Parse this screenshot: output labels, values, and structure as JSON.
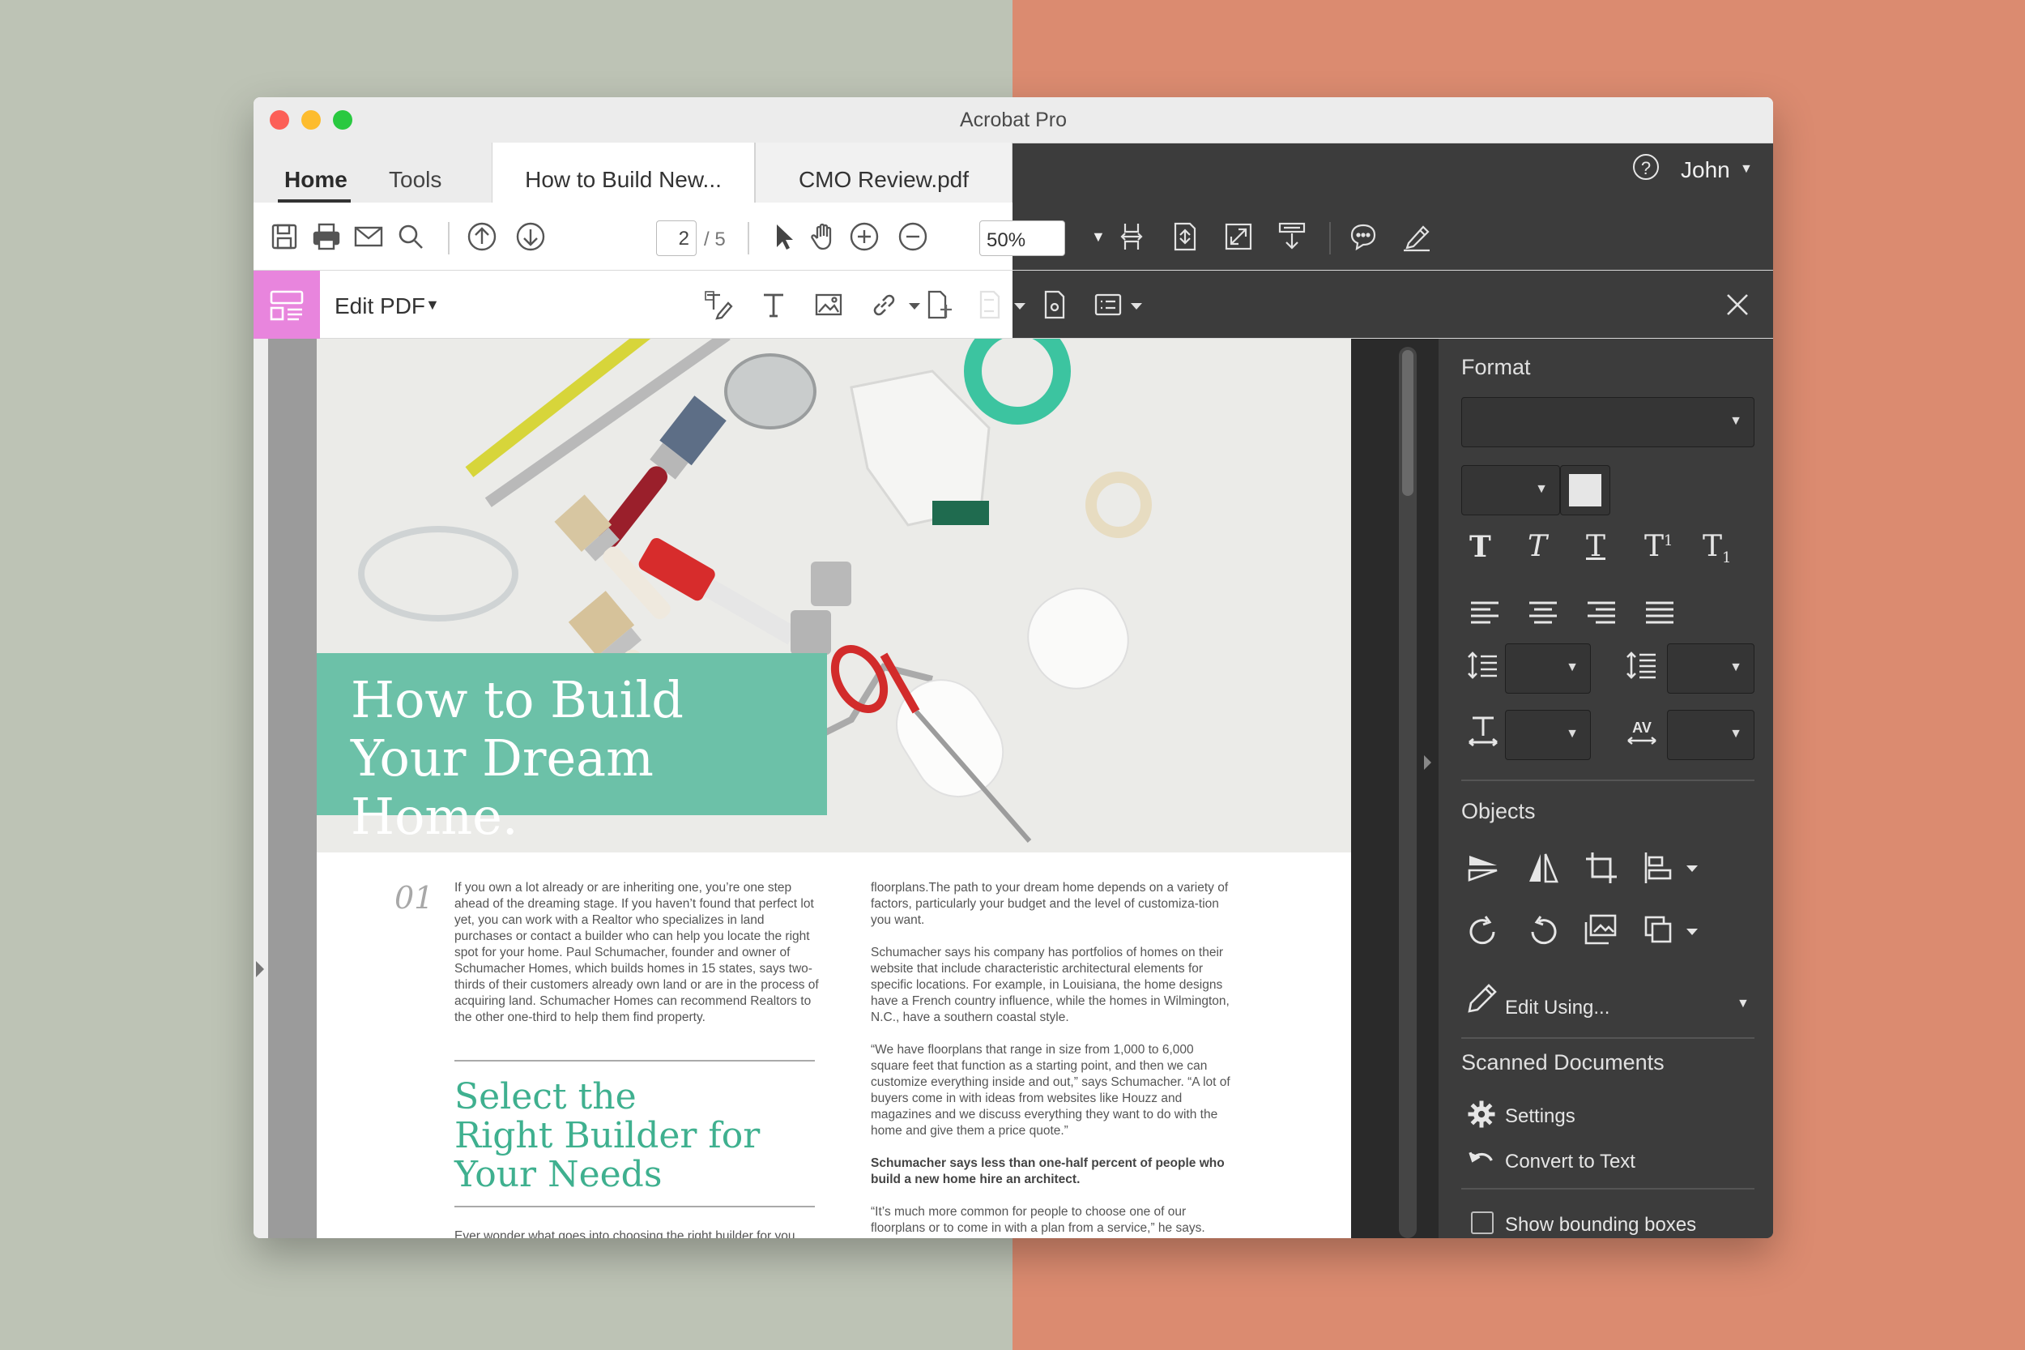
{
  "window": {
    "title": "Acrobat Pro"
  },
  "nav": {
    "home": "Home",
    "tools": "Tools"
  },
  "tabs": [
    {
      "label": "How to Build New..."
    },
    {
      "label": "CMO Review.pdf"
    }
  ],
  "user": {
    "name": "John",
    "help_glyph": "?"
  },
  "toolbar": {
    "page_current": "2",
    "page_total": "/ 5",
    "zoom": "50%"
  },
  "edit": {
    "label": "Edit PDF"
  },
  "document": {
    "hero_title": "How to Build\nYour Dream Home.",
    "section_number": "01",
    "col1": "If you own a lot already or are inheriting one, you’re one step ahead of the dreaming stage. If you haven’t found that perfect lot yet, you can work with a Realtor who specializes in land purchases or contact a builder who can help you locate the right spot for your home. Paul Schumacher, founder and owner of Schumacher Homes, which builds homes in 15 states, says two-thirds of their customers already own land or are in the process of acquiring land. Schumacher Homes can recommend Realtors to the other one-third to help them find property.",
    "subheading": "Select the\nRight Builder for\nYour Needs",
    "col1_tail": "Ever wonder what goes into choosing the right builder for you",
    "col2_p1": "floorplans.The path to your dream home depends on a variety of factors, particularly your budget and the level of customiza-tion you want.",
    "col2_p2": "Schumacher says his company has portfolios of homes on their website that include characteristic architectural elements for specific locations. For example, in Louisiana, the home designs have a French country influence, while the homes in Wilmington, N.C., have a southern coastal style.",
    "col2_p3": "“We have floorplans that range in size from 1,000 to 6,000 square feet that function as a starting point, and then we can customize everything inside and out,” says Schumacher. “A lot of buyers come in with ideas from websites like Houzz and magazines and we discuss everything they want to do with the home and give them a price quote.”",
    "col2_p4": "Schumacher says less than one-half percent of people who build a new home hire an architect.",
    "col2_p5": "“It’s much more common for people to choose one of our floorplans or to come in with a plan from a service,” he says."
  },
  "panel": {
    "format_heading": "Format",
    "objects_heading": "Objects",
    "edit_using": "Edit Using...",
    "scanned_heading": "Scanned Documents",
    "settings": "Settings",
    "convert": "Convert to Text",
    "show_bbox": "Show bounding boxes",
    "superscript_mark": "1",
    "subscript_mark": "1",
    "tracking_mark": "AV"
  },
  "colors": {
    "accent_pink": "#e885dd",
    "hero_green": "#6cc1a8",
    "heading_green": "#3fb08f",
    "dark_ui": "#3c3c3c"
  }
}
